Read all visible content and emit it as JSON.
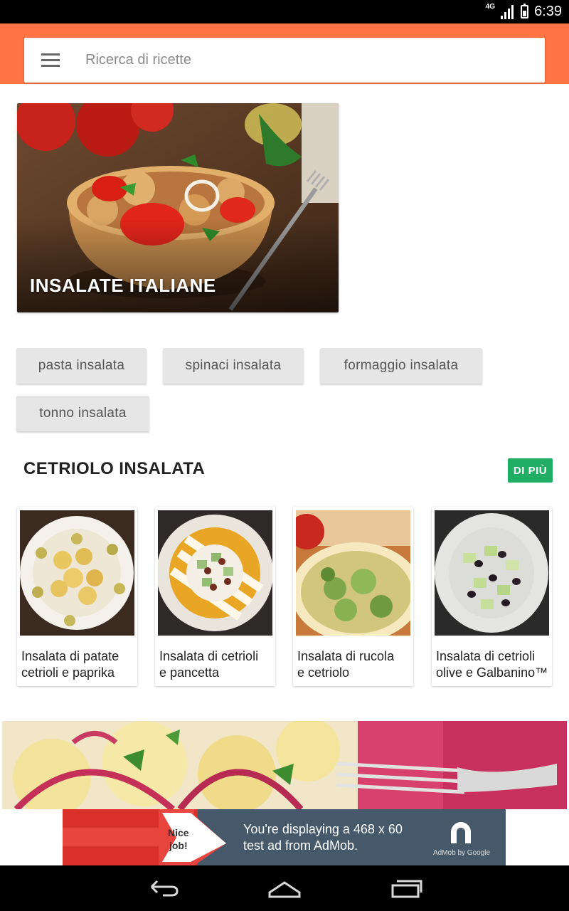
{
  "status_bar": {
    "network": "4G",
    "time": "6:39"
  },
  "search": {
    "placeholder": "Ricerca di ricette"
  },
  "hero": {
    "title": "INSALATE ITALIANE"
  },
  "chips": [
    "pasta insalata",
    "spinaci insalata",
    "formaggio insalata",
    "tonno insalata"
  ],
  "section": {
    "title": "CETRIOLO INSALATA",
    "more_label": "DI PIÙ",
    "recipes": [
      {
        "line1": "Insalata di patate",
        "line2": "cetrioli e paprika"
      },
      {
        "line1": "Insalata di cetrioli",
        "line2": "e pancetta"
      },
      {
        "line1": "Insalata di rucola",
        "line2": "e cetriolo"
      },
      {
        "line1": "Insalata di cetrioli",
        "line2": "olive e Galbanino™"
      }
    ]
  },
  "ad": {
    "badge": "Nice job!",
    "badge_line1": "Nice",
    "badge_line2": "job!",
    "line1": "You're displaying a 468 x 60",
    "line2": "test ad from AdMob.",
    "brand": "AdMob by Google"
  },
  "colors": {
    "app_bar": "#ff7444",
    "more_button": "#1fae64",
    "ad_bg": "#45596a"
  },
  "icons": [
    "menu-icon",
    "back-icon",
    "home-icon",
    "recents-icon",
    "signal-icon",
    "battery-icon"
  ]
}
